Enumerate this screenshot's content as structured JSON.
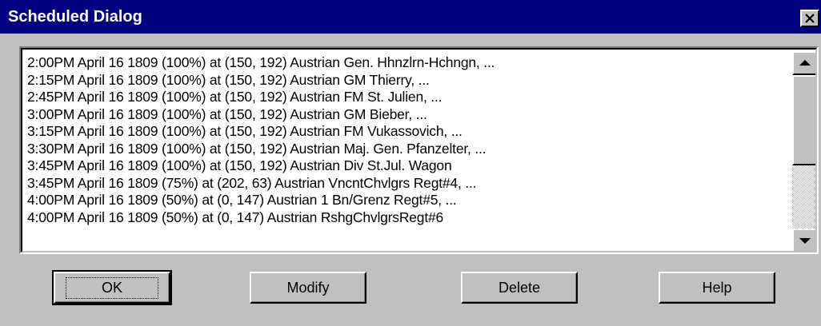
{
  "window": {
    "title": "Scheduled Dialog",
    "close_label": "close"
  },
  "schedule_list": {
    "items": [
      "2:00PM April 16 1809 (100%) at (150, 192) Austrian Gen. Hhnzlrn-Hchngn, ...",
      "2:15PM April 16 1809 (100%) at (150, 192) Austrian GM Thierry, ...",
      "2:45PM April 16 1809 (100%) at (150, 192) Austrian FM St. Julien, ...",
      "3:00PM April 16 1809 (100%) at (150, 192) Austrian GM Bieber, ...",
      "3:15PM April 16 1809 (100%) at (150, 192) Austrian FM Vukassovich, ...",
      "3:30PM April 16 1809 (100%) at (150, 192) Austrian Maj. Gen. Pfanzelter, ...",
      "3:45PM April 16 1809 (100%) at (150, 192) Austrian Div St.Jul. Wagon",
      "3:45PM April 16 1809 (75%) at (202, 63) Austrian VncntChvlgrs Regt#4, ...",
      "4:00PM April 16 1809 (50%) at (0, 147) Austrian 1 Bn/Grenz Regt#5, ...",
      "4:00PM April 16 1809 (50%) at (0, 147) Austrian RshgChvlgrsRegt#6"
    ],
    "scroll_position": 0.0
  },
  "buttons": {
    "ok": "OK",
    "modify": "Modify",
    "delete": "Delete",
    "help": "Help"
  },
  "icons": {
    "close": "close-icon",
    "scroll_up": "arrow-up-icon",
    "scroll_down": "arrow-down-icon"
  },
  "colors": {
    "titlebar": "#000080",
    "face": "#c0c0c0",
    "list_background": "#ffffff"
  }
}
